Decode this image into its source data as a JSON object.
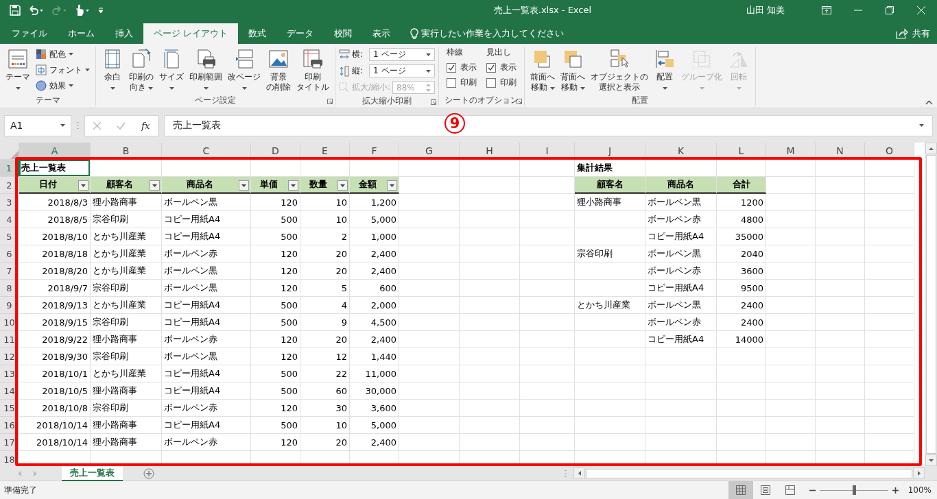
{
  "window": {
    "title": "売上一覧表.xlsx  -  Excel",
    "user": "山田 知美"
  },
  "ribbon_tabs": [
    {
      "label": "ファイル",
      "selected": false
    },
    {
      "label": "ホーム",
      "selected": false
    },
    {
      "label": "挿入",
      "selected": false
    },
    {
      "label": "ページ レイアウト",
      "selected": true
    },
    {
      "label": "数式",
      "selected": false
    },
    {
      "label": "データ",
      "selected": false
    },
    {
      "label": "校閲",
      "selected": false
    },
    {
      "label": "表示",
      "selected": false
    }
  ],
  "tell_me": {
    "placeholder": "実行したい作業を入力してください"
  },
  "share": "共有",
  "ribbon_groups": [
    {
      "label": "テーマ",
      "launcher": false,
      "items": [
        {
          "kind": "large",
          "lines": [
            "テーマ"
          ],
          "dropdown": true,
          "disabled": false
        },
        {
          "kind": "stack",
          "items": [
            {
              "kind": "small",
              "label": "配色",
              "dropdown": true
            },
            {
              "kind": "small",
              "label": "フォント",
              "dropdown": true
            },
            {
              "kind": "small",
              "label": "効果",
              "dropdown": true
            }
          ]
        }
      ]
    },
    {
      "label": "ページ設定",
      "launcher": true,
      "items": [
        {
          "kind": "large",
          "lines": [
            "余白"
          ],
          "dropdown": true,
          "disabled": false
        },
        {
          "kind": "large",
          "lines": [
            "印刷の",
            "向き"
          ],
          "dropdown": true,
          "disabled": false
        },
        {
          "kind": "large",
          "lines": [
            "サイズ"
          ],
          "dropdown": true,
          "disabled": false
        },
        {
          "kind": "large",
          "lines": [
            "印刷範囲"
          ],
          "dropdown": true,
          "disabled": false
        },
        {
          "kind": "large",
          "lines": [
            "改ページ"
          ],
          "dropdown": true,
          "disabled": false
        },
        {
          "kind": "large",
          "lines": [
            "背景",
            "の削除"
          ],
          "dropdown": false,
          "disabled": false
        },
        {
          "kind": "large",
          "lines": [
            "印刷",
            "タイトル"
          ],
          "dropdown": false,
          "disabled": false
        }
      ]
    },
    {
      "label": "拡大縮小印刷",
      "launcher": true,
      "items": [
        {
          "kind": "stack",
          "items": [
            {
              "kind": "dropdown",
              "label": "横:",
              "value": "1 ページ",
              "disabled": false
            },
            {
              "kind": "dropdown",
              "label": "縦:",
              "value": "1 ページ",
              "disabled": false
            },
            {
              "kind": "spinner",
              "label": "拡大/縮小:",
              "value": "88%",
              "disabled": true
            }
          ]
        }
      ]
    },
    {
      "label": "シートのオプション",
      "launcher": true,
      "items": [
        {
          "kind": "checks",
          "heading": "枠線",
          "options": [
            {
              "label": "表示",
              "checked": true
            },
            {
              "label": "印刷",
              "checked": false
            }
          ]
        },
        {
          "kind": "checks",
          "heading": "見出し",
          "options": [
            {
              "label": "表示",
              "checked": true
            },
            {
              "label": "印刷",
              "checked": false
            }
          ]
        }
      ]
    },
    {
      "label": "配置",
      "launcher": false,
      "items": [
        {
          "kind": "large",
          "lines": [
            "前面へ",
            "移動"
          ],
          "dropdown": true,
          "disabled": false
        },
        {
          "kind": "large",
          "lines": [
            "背面へ",
            "移動"
          ],
          "dropdown": true,
          "disabled": false
        },
        {
          "kind": "large",
          "lines": [
            "オブジェクトの",
            "選択と表示"
          ],
          "dropdown": false,
          "disabled": false
        },
        {
          "kind": "large",
          "lines": [
            "配置"
          ],
          "dropdown": true,
          "disabled": false
        },
        {
          "kind": "large",
          "lines": [
            "グループ化"
          ],
          "dropdown": true,
          "disabled": true
        },
        {
          "kind": "large",
          "lines": [
            "回転"
          ],
          "dropdown": true,
          "disabled": true
        }
      ]
    }
  ],
  "formula_bar": {
    "name_box": "A1",
    "function_button": "fx",
    "formula": "売上一覧表"
  },
  "annotation": {
    "label": "9"
  },
  "sheet": {
    "columns": [
      {
        "label": "A",
        "selected": true
      },
      {
        "label": "B",
        "selected": false
      },
      {
        "label": "C",
        "selected": false
      },
      {
        "label": "D",
        "selected": false
      },
      {
        "label": "E",
        "selected": false
      },
      {
        "label": "F",
        "selected": false
      },
      {
        "label": "G",
        "selected": false
      },
      {
        "label": "H",
        "selected": false
      },
      {
        "label": "I",
        "selected": false
      },
      {
        "label": "J",
        "selected": false
      },
      {
        "label": "K",
        "selected": false
      },
      {
        "label": "L",
        "selected": false
      },
      {
        "label": "M",
        "selected": false
      },
      {
        "label": "N",
        "selected": false
      },
      {
        "label": "O",
        "selected": false
      }
    ],
    "rows": [
      {
        "number": "1",
        "selected": true,
        "cells": [
          {
            "text": "売上一覧表",
            "kind": "title"
          },
          null,
          null,
          null,
          null,
          null,
          null,
          null,
          null,
          {
            "text": "集計結果",
            "kind": "title"
          },
          null,
          null,
          null,
          null,
          null
        ]
      },
      {
        "number": "2",
        "selected": false,
        "cells": [
          {
            "text": "日付",
            "kind": "filter-header"
          },
          {
            "text": "顧客名",
            "kind": "filter-header"
          },
          {
            "text": "商品名",
            "kind": "filter-header"
          },
          {
            "text": "単価",
            "kind": "filter-header"
          },
          {
            "text": "数量",
            "kind": "filter-header"
          },
          {
            "text": "金額",
            "kind": "filter-header"
          },
          null,
          null,
          null,
          {
            "text": "顧客名",
            "kind": "header"
          },
          {
            "text": "商品名",
            "kind": "header"
          },
          {
            "text": "合計",
            "kind": "header"
          },
          null,
          null,
          null
        ]
      },
      {
        "number": "3",
        "selected": false,
        "cells": [
          {
            "text": "2018/8/3",
            "kind": "number"
          },
          {
            "text": "狸小路商事",
            "kind": "text"
          },
          {
            "text": "ボールペン黒",
            "kind": "text"
          },
          {
            "text": "120",
            "kind": "number"
          },
          {
            "text": "10",
            "kind": "number"
          },
          {
            "text": "1,200",
            "kind": "number"
          },
          null,
          null,
          null,
          {
            "text": "狸小路商事",
            "kind": "text"
          },
          {
            "text": "ボールペン黒",
            "kind": "text"
          },
          {
            "text": "1200",
            "kind": "number"
          },
          null,
          null,
          null
        ]
      },
      {
        "number": "4",
        "selected": false,
        "cells": [
          {
            "text": "2018/8/5",
            "kind": "number"
          },
          {
            "text": "宗谷印刷",
            "kind": "text"
          },
          {
            "text": "コピー用紙A4",
            "kind": "text"
          },
          {
            "text": "500",
            "kind": "number"
          },
          {
            "text": "10",
            "kind": "number"
          },
          {
            "text": "5,000",
            "kind": "number"
          },
          null,
          null,
          null,
          null,
          {
            "text": "ボールペン赤",
            "kind": "text"
          },
          {
            "text": "4800",
            "kind": "number"
          },
          null,
          null,
          null
        ]
      },
      {
        "number": "5",
        "selected": false,
        "cells": [
          {
            "text": "2018/8/10",
            "kind": "number"
          },
          {
            "text": "とかち川産業",
            "kind": "text"
          },
          {
            "text": "コピー用紙A4",
            "kind": "text"
          },
          {
            "text": "500",
            "kind": "number"
          },
          {
            "text": "2",
            "kind": "number"
          },
          {
            "text": "1,000",
            "kind": "number"
          },
          null,
          null,
          null,
          null,
          {
            "text": "コピー用紙A4",
            "kind": "text"
          },
          {
            "text": "35000",
            "kind": "number"
          },
          null,
          null,
          null
        ]
      },
      {
        "number": "6",
        "selected": false,
        "cells": [
          {
            "text": "2018/8/18",
            "kind": "number"
          },
          {
            "text": "とかち川産業",
            "kind": "text"
          },
          {
            "text": "ボールペン赤",
            "kind": "text"
          },
          {
            "text": "120",
            "kind": "number"
          },
          {
            "text": "20",
            "kind": "number"
          },
          {
            "text": "2,400",
            "kind": "number"
          },
          null,
          null,
          null,
          {
            "text": "宗谷印刷",
            "kind": "text"
          },
          {
            "text": "ボールペン黒",
            "kind": "text"
          },
          {
            "text": "2040",
            "kind": "number"
          },
          null,
          null,
          null
        ]
      },
      {
        "number": "7",
        "selected": false,
        "cells": [
          {
            "text": "2018/8/20",
            "kind": "number"
          },
          {
            "text": "とかち川産業",
            "kind": "text"
          },
          {
            "text": "ボールペン黒",
            "kind": "text"
          },
          {
            "text": "120",
            "kind": "number"
          },
          {
            "text": "20",
            "kind": "number"
          },
          {
            "text": "2,400",
            "kind": "number"
          },
          null,
          null,
          null,
          null,
          {
            "text": "ボールペン赤",
            "kind": "text"
          },
          {
            "text": "3600",
            "kind": "number"
          },
          null,
          null,
          null
        ]
      },
      {
        "number": "8",
        "selected": false,
        "cells": [
          {
            "text": "2018/9/7",
            "kind": "number"
          },
          {
            "text": "宗谷印刷",
            "kind": "text"
          },
          {
            "text": "ボールペン黒",
            "kind": "text"
          },
          {
            "text": "120",
            "kind": "number"
          },
          {
            "text": "5",
            "kind": "number"
          },
          {
            "text": "600",
            "kind": "number"
          },
          null,
          null,
          null,
          null,
          {
            "text": "コピー用紙A4",
            "kind": "text"
          },
          {
            "text": "9500",
            "kind": "number"
          },
          null,
          null,
          null
        ]
      },
      {
        "number": "9",
        "selected": false,
        "cells": [
          {
            "text": "2018/9/13",
            "kind": "number"
          },
          {
            "text": "とかち川産業",
            "kind": "text"
          },
          {
            "text": "コピー用紙A4",
            "kind": "text"
          },
          {
            "text": "500",
            "kind": "number"
          },
          {
            "text": "4",
            "kind": "number"
          },
          {
            "text": "2,000",
            "kind": "number"
          },
          null,
          null,
          null,
          {
            "text": "とかち川産業",
            "kind": "text"
          },
          {
            "text": "ボールペン黒",
            "kind": "text"
          },
          {
            "text": "2400",
            "kind": "number"
          },
          null,
          null,
          null
        ]
      },
      {
        "number": "10",
        "selected": false,
        "cells": [
          {
            "text": "2018/9/15",
            "kind": "number"
          },
          {
            "text": "宗谷印刷",
            "kind": "text"
          },
          {
            "text": "コピー用紙A4",
            "kind": "text"
          },
          {
            "text": "500",
            "kind": "number"
          },
          {
            "text": "9",
            "kind": "number"
          },
          {
            "text": "4,500",
            "kind": "number"
          },
          null,
          null,
          null,
          null,
          {
            "text": "ボールペン赤",
            "kind": "text"
          },
          {
            "text": "2400",
            "kind": "number"
          },
          null,
          null,
          null
        ]
      },
      {
        "number": "11",
        "selected": false,
        "cells": [
          {
            "text": "2018/9/22",
            "kind": "number"
          },
          {
            "text": "狸小路商事",
            "kind": "text"
          },
          {
            "text": "ボールペン赤",
            "kind": "text"
          },
          {
            "text": "120",
            "kind": "number"
          },
          {
            "text": "20",
            "kind": "number"
          },
          {
            "text": "2,400",
            "kind": "number"
          },
          null,
          null,
          null,
          null,
          {
            "text": "コピー用紙A4",
            "kind": "text"
          },
          {
            "text": "14000",
            "kind": "number"
          },
          null,
          null,
          null
        ]
      },
      {
        "number": "12",
        "selected": false,
        "cells": [
          {
            "text": "2018/9/30",
            "kind": "number"
          },
          {
            "text": "宗谷印刷",
            "kind": "text"
          },
          {
            "text": "ボールペン黒",
            "kind": "text"
          },
          {
            "text": "120",
            "kind": "number"
          },
          {
            "text": "12",
            "kind": "number"
          },
          {
            "text": "1,440",
            "kind": "number"
          },
          null,
          null,
          null,
          null,
          null,
          null,
          null,
          null,
          null
        ]
      },
      {
        "number": "13",
        "selected": false,
        "cells": [
          {
            "text": "2018/10/1",
            "kind": "number"
          },
          {
            "text": "とかち川産業",
            "kind": "text"
          },
          {
            "text": "コピー用紙A4",
            "kind": "text"
          },
          {
            "text": "500",
            "kind": "number"
          },
          {
            "text": "22",
            "kind": "number"
          },
          {
            "text": "11,000",
            "kind": "number"
          },
          null,
          null,
          null,
          null,
          null,
          null,
          null,
          null,
          null
        ]
      },
      {
        "number": "14",
        "selected": false,
        "cells": [
          {
            "text": "2018/10/5",
            "kind": "number"
          },
          {
            "text": "狸小路商事",
            "kind": "text"
          },
          {
            "text": "コピー用紙A4",
            "kind": "text"
          },
          {
            "text": "500",
            "kind": "number"
          },
          {
            "text": "60",
            "kind": "number"
          },
          {
            "text": "30,000",
            "kind": "number"
          },
          null,
          null,
          null,
          null,
          null,
          null,
          null,
          null,
          null
        ]
      },
      {
        "number": "15",
        "selected": false,
        "cells": [
          {
            "text": "2018/10/8",
            "kind": "number"
          },
          {
            "text": "宗谷印刷",
            "kind": "text"
          },
          {
            "text": "ボールペン赤",
            "kind": "text"
          },
          {
            "text": "120",
            "kind": "number"
          },
          {
            "text": "30",
            "kind": "number"
          },
          {
            "text": "3,600",
            "kind": "number"
          },
          null,
          null,
          null,
          null,
          null,
          null,
          null,
          null,
          null
        ]
      },
      {
        "number": "16",
        "selected": false,
        "cells": [
          {
            "text": "2018/10/14",
            "kind": "number"
          },
          {
            "text": "狸小路商事",
            "kind": "text"
          },
          {
            "text": "コピー用紙A4",
            "kind": "text"
          },
          {
            "text": "500",
            "kind": "number"
          },
          {
            "text": "10",
            "kind": "number"
          },
          {
            "text": "5,000",
            "kind": "number"
          },
          null,
          null,
          null,
          null,
          null,
          null,
          null,
          null,
          null
        ]
      },
      {
        "number": "17",
        "selected": false,
        "cells": [
          {
            "text": "2018/10/14",
            "kind": "number"
          },
          {
            "text": "狸小路商事",
            "kind": "text"
          },
          {
            "text": "ボールペン赤",
            "kind": "text"
          },
          {
            "text": "120",
            "kind": "number"
          },
          {
            "text": "20",
            "kind": "number"
          },
          {
            "text": "2,400",
            "kind": "number"
          },
          null,
          null,
          null,
          null,
          null,
          null,
          null,
          null,
          null
        ]
      },
      {
        "number": "18",
        "selected": false,
        "cells": [
          null,
          null,
          null,
          null,
          null,
          null,
          null,
          null,
          null,
          null,
          null,
          null,
          null,
          null,
          null
        ]
      }
    ]
  },
  "sheet_tabs": [
    {
      "label": "売上一覧表",
      "selected": true
    }
  ],
  "status_bar": {
    "status": "準備完了",
    "views": [
      {
        "selected": true
      },
      {
        "selected": false
      },
      {
        "selected": false
      }
    ],
    "zoom": {
      "level": 0.5,
      "label": "100%"
    }
  }
}
